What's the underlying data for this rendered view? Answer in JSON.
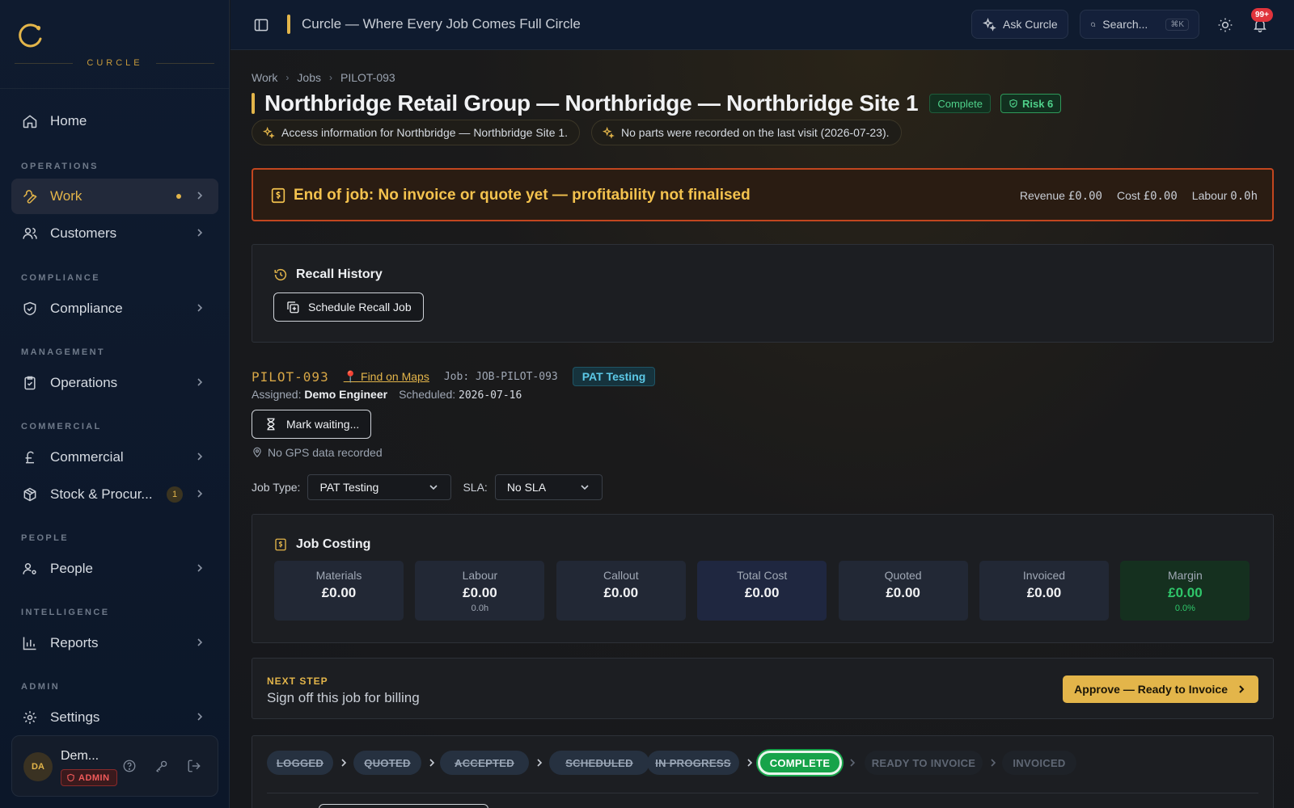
{
  "app": {
    "brand": "CURCLE",
    "title": "Curcle — Where Every Job Comes Full Circle",
    "accent": "#e3b54a"
  },
  "topbar": {
    "ask_label": "Ask Curcle",
    "search_placeholder": "Search...",
    "search_shortcut": "⌘K",
    "notifications_count": "99+"
  },
  "sidebar": {
    "home": "Home",
    "sections": {
      "operations": "OPERATIONS",
      "compliance": "COMPLIANCE",
      "management": "MANAGEMENT",
      "commercial": "COMMERCIAL",
      "people": "PEOPLE",
      "intelligence": "INTELLIGENCE",
      "admin": "ADMIN"
    },
    "items": {
      "work": "Work",
      "customers": "Customers",
      "compliance": "Compliance",
      "operations": "Operations",
      "commercial": "Commercial",
      "stock": "Stock & Procur...",
      "stock_count": "1",
      "people": "People",
      "reports": "Reports",
      "settings": "Settings"
    },
    "user": {
      "initials": "DA",
      "name": "Dem...",
      "role": "ADMIN"
    }
  },
  "breadcrumb": [
    "Work",
    "Jobs",
    "PILOT-093"
  ],
  "job": {
    "title": "Northbridge Retail Group — Northbridge — Northbridge Site 1",
    "status": "Complete",
    "risk": "Risk 6",
    "hints": [
      "Access information for Northbridge — Northbridge Site 1.",
      "No parts were recorded on the last visit (2026-07-23)."
    ],
    "alert": {
      "text": "End of job: No invoice or quote yet — profitability not finalised",
      "revenue_label": "Revenue",
      "revenue": "£0.00",
      "cost_label": "Cost",
      "cost": "£0.00",
      "labour_label": "Labour",
      "labour": "0.0h"
    },
    "recall": {
      "title": "Recall History",
      "button": "Schedule Recall Job"
    },
    "ref": "PILOT-093",
    "maps_link": "📍 Find on Maps",
    "job_number": "Job: JOB-PILOT-093",
    "type_badge": "PAT Testing",
    "assigned_label": "Assigned:",
    "assigned": "Demo Engineer",
    "scheduled_label": "Scheduled:",
    "scheduled": "2026-07-16",
    "mark_waiting": "Mark waiting...",
    "gps": "No GPS data recorded",
    "job_type_label": "Job Type:",
    "job_type_value": "PAT Testing",
    "sla_label": "SLA:",
    "sla_value": "No SLA"
  },
  "costing": {
    "title": "Job Costing",
    "tiles": [
      {
        "label": "Materials",
        "value": "£0.00",
        "sub": ""
      },
      {
        "label": "Labour",
        "value": "£0.00",
        "sub": "0.0h"
      },
      {
        "label": "Callout",
        "value": "£0.00",
        "sub": ""
      },
      {
        "label": "Total Cost",
        "value": "£0.00",
        "sub": ""
      },
      {
        "label": "Quoted",
        "value": "£0.00",
        "sub": ""
      },
      {
        "label": "Invoiced",
        "value": "£0.00",
        "sub": ""
      },
      {
        "label": "Margin",
        "value": "£0.00",
        "sub": "0.0%"
      }
    ],
    "margin_color": "#2fc66a"
  },
  "next_step": {
    "label": "NEXT STEP",
    "text": "Sign off this job for billing",
    "button": "Approve — Ready to Invoice"
  },
  "pipeline": {
    "stages": [
      "LOGGED",
      "QUOTED",
      "ACCEPTED",
      "SCHEDULED",
      "IN PROGRESS",
      "COMPLETE",
      "READY TO INVOICE",
      "INVOICED"
    ],
    "current": "COMPLETE"
  }
}
